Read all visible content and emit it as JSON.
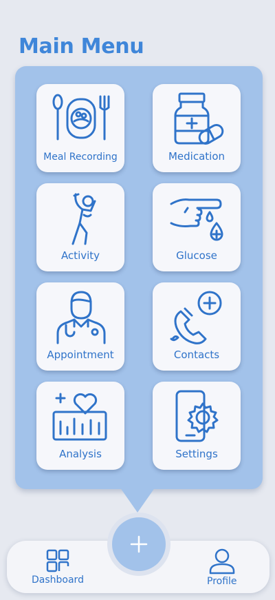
{
  "header": {
    "title": "Main Menu"
  },
  "menu": {
    "items": [
      {
        "label": "Meal Recording",
        "icon": "meal-icon"
      },
      {
        "label": "Medication",
        "icon": "medication-icon"
      },
      {
        "label": "Activity",
        "icon": "activity-icon"
      },
      {
        "label": "Glucose",
        "icon": "glucose-icon"
      },
      {
        "label": "Appointment",
        "icon": "doctor-icon"
      },
      {
        "label": "Contacts",
        "icon": "phone-icon"
      },
      {
        "label": "Analysis",
        "icon": "analysis-icon"
      },
      {
        "label": "Settings",
        "icon": "settings-icon"
      }
    ]
  },
  "bottom_nav": {
    "dashboard_label": "Dashboard",
    "profile_label": "Profile",
    "fab_symbol": "+"
  },
  "colors": {
    "background": "#e6e9f0",
    "panel": "#a2c2ea",
    "accent": "#3f86d9",
    "icon_stroke": "#2f73c9",
    "tile": "#f6f7fb"
  }
}
